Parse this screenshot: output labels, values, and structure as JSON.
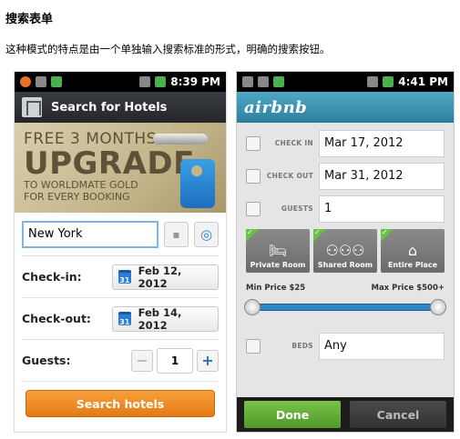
{
  "heading": "搜索表单",
  "subtitle": "这种模式的特点是由一个单独输入搜索标准的形式，明确的搜索按钮。",
  "left_phone": {
    "status_time": "8:39 PM",
    "title": "Search for Hotels",
    "promo": {
      "line1": "FREE 3 MONTHS",
      "line2": "UPGRADE",
      "line3": "TO WORLDMATE GOLD",
      "line4": "FOR EVERY BOOKING"
    },
    "city_value": "New York",
    "checkin_label": "Check-in:",
    "checkin_value": "Feb 12, 2012",
    "checkout_label": "Check-out:",
    "checkout_value": "Feb 14, 2012",
    "calendar_day": "31",
    "guests_label": "Guests:",
    "guests_value": "1",
    "minus": "−",
    "plus": "+",
    "search_button": "Search hotels"
  },
  "right_phone": {
    "status_time": "4:41 PM",
    "logo": "airbnb",
    "checkin_label": "CHECK IN",
    "checkin_value": "Mar 17, 2012",
    "checkout_label": "CHECK OUT",
    "checkout_value": "Mar 31, 2012",
    "guests_label": "GUESTS",
    "guests_value": "1",
    "room_types": [
      {
        "label": "Private Room",
        "glyph": "🛏"
      },
      {
        "label": "Shared Room",
        "glyph": "⚇⚇⚇"
      },
      {
        "label": "Entire Place",
        "glyph": "⌂"
      }
    ],
    "min_price": "Min Price $25",
    "max_price": "Max Price $500+",
    "beds_label": "BEDS",
    "beds_value": "Any",
    "done": "Done",
    "cancel": "Cancel"
  }
}
